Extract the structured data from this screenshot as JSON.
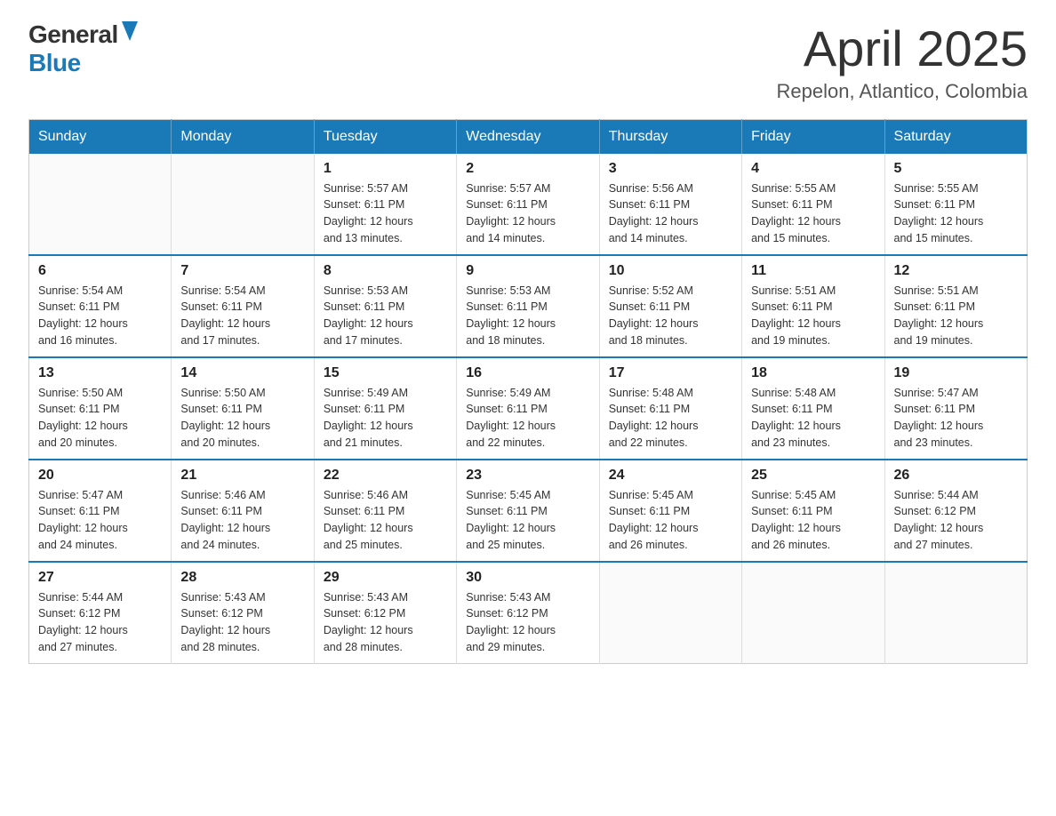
{
  "logo": {
    "general": "General",
    "blue": "Blue"
  },
  "title": {
    "month_year": "April 2025",
    "location": "Repelon, Atlantico, Colombia"
  },
  "calendar": {
    "headers": [
      "Sunday",
      "Monday",
      "Tuesday",
      "Wednesday",
      "Thursday",
      "Friday",
      "Saturday"
    ],
    "weeks": [
      [
        {
          "day": "",
          "info": ""
        },
        {
          "day": "",
          "info": ""
        },
        {
          "day": "1",
          "info": "Sunrise: 5:57 AM\nSunset: 6:11 PM\nDaylight: 12 hours\nand 13 minutes."
        },
        {
          "day": "2",
          "info": "Sunrise: 5:57 AM\nSunset: 6:11 PM\nDaylight: 12 hours\nand 14 minutes."
        },
        {
          "day": "3",
          "info": "Sunrise: 5:56 AM\nSunset: 6:11 PM\nDaylight: 12 hours\nand 14 minutes."
        },
        {
          "day": "4",
          "info": "Sunrise: 5:55 AM\nSunset: 6:11 PM\nDaylight: 12 hours\nand 15 minutes."
        },
        {
          "day": "5",
          "info": "Sunrise: 5:55 AM\nSunset: 6:11 PM\nDaylight: 12 hours\nand 15 minutes."
        }
      ],
      [
        {
          "day": "6",
          "info": "Sunrise: 5:54 AM\nSunset: 6:11 PM\nDaylight: 12 hours\nand 16 minutes."
        },
        {
          "day": "7",
          "info": "Sunrise: 5:54 AM\nSunset: 6:11 PM\nDaylight: 12 hours\nand 17 minutes."
        },
        {
          "day": "8",
          "info": "Sunrise: 5:53 AM\nSunset: 6:11 PM\nDaylight: 12 hours\nand 17 minutes."
        },
        {
          "day": "9",
          "info": "Sunrise: 5:53 AM\nSunset: 6:11 PM\nDaylight: 12 hours\nand 18 minutes."
        },
        {
          "day": "10",
          "info": "Sunrise: 5:52 AM\nSunset: 6:11 PM\nDaylight: 12 hours\nand 18 minutes."
        },
        {
          "day": "11",
          "info": "Sunrise: 5:51 AM\nSunset: 6:11 PM\nDaylight: 12 hours\nand 19 minutes."
        },
        {
          "day": "12",
          "info": "Sunrise: 5:51 AM\nSunset: 6:11 PM\nDaylight: 12 hours\nand 19 minutes."
        }
      ],
      [
        {
          "day": "13",
          "info": "Sunrise: 5:50 AM\nSunset: 6:11 PM\nDaylight: 12 hours\nand 20 minutes."
        },
        {
          "day": "14",
          "info": "Sunrise: 5:50 AM\nSunset: 6:11 PM\nDaylight: 12 hours\nand 20 minutes."
        },
        {
          "day": "15",
          "info": "Sunrise: 5:49 AM\nSunset: 6:11 PM\nDaylight: 12 hours\nand 21 minutes."
        },
        {
          "day": "16",
          "info": "Sunrise: 5:49 AM\nSunset: 6:11 PM\nDaylight: 12 hours\nand 22 minutes."
        },
        {
          "day": "17",
          "info": "Sunrise: 5:48 AM\nSunset: 6:11 PM\nDaylight: 12 hours\nand 22 minutes."
        },
        {
          "day": "18",
          "info": "Sunrise: 5:48 AM\nSunset: 6:11 PM\nDaylight: 12 hours\nand 23 minutes."
        },
        {
          "day": "19",
          "info": "Sunrise: 5:47 AM\nSunset: 6:11 PM\nDaylight: 12 hours\nand 23 minutes."
        }
      ],
      [
        {
          "day": "20",
          "info": "Sunrise: 5:47 AM\nSunset: 6:11 PM\nDaylight: 12 hours\nand 24 minutes."
        },
        {
          "day": "21",
          "info": "Sunrise: 5:46 AM\nSunset: 6:11 PM\nDaylight: 12 hours\nand 24 minutes."
        },
        {
          "day": "22",
          "info": "Sunrise: 5:46 AM\nSunset: 6:11 PM\nDaylight: 12 hours\nand 25 minutes."
        },
        {
          "day": "23",
          "info": "Sunrise: 5:45 AM\nSunset: 6:11 PM\nDaylight: 12 hours\nand 25 minutes."
        },
        {
          "day": "24",
          "info": "Sunrise: 5:45 AM\nSunset: 6:11 PM\nDaylight: 12 hours\nand 26 minutes."
        },
        {
          "day": "25",
          "info": "Sunrise: 5:45 AM\nSunset: 6:11 PM\nDaylight: 12 hours\nand 26 minutes."
        },
        {
          "day": "26",
          "info": "Sunrise: 5:44 AM\nSunset: 6:12 PM\nDaylight: 12 hours\nand 27 minutes."
        }
      ],
      [
        {
          "day": "27",
          "info": "Sunrise: 5:44 AM\nSunset: 6:12 PM\nDaylight: 12 hours\nand 27 minutes."
        },
        {
          "day": "28",
          "info": "Sunrise: 5:43 AM\nSunset: 6:12 PM\nDaylight: 12 hours\nand 28 minutes."
        },
        {
          "day": "29",
          "info": "Sunrise: 5:43 AM\nSunset: 6:12 PM\nDaylight: 12 hours\nand 28 minutes."
        },
        {
          "day": "30",
          "info": "Sunrise: 5:43 AM\nSunset: 6:12 PM\nDaylight: 12 hours\nand 29 minutes."
        },
        {
          "day": "",
          "info": ""
        },
        {
          "day": "",
          "info": ""
        },
        {
          "day": "",
          "info": ""
        }
      ]
    ]
  }
}
